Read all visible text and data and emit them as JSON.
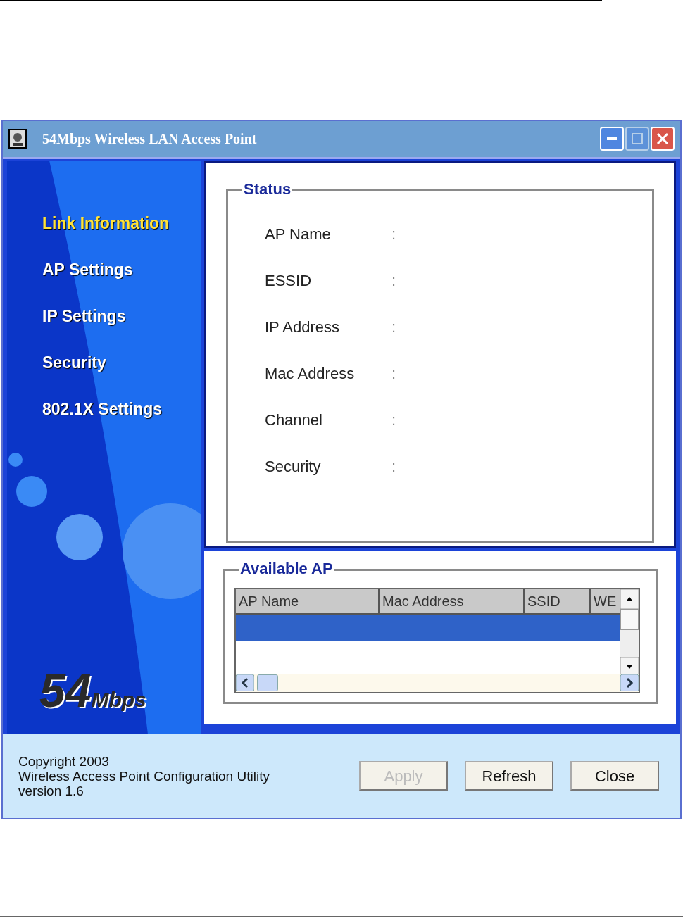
{
  "window": {
    "title": "54Mbps Wireless LAN Access Point",
    "controls": [
      {
        "kind": "minimize",
        "disabled": false
      },
      {
        "kind": "maximize",
        "disabled": true
      },
      {
        "kind": "close",
        "disabled": false
      }
    ]
  },
  "sidebar": {
    "items": [
      {
        "label": "Link Information",
        "selected": true
      },
      {
        "label": "AP Settings",
        "selected": false
      },
      {
        "label": "IP Settings",
        "selected": false
      },
      {
        "label": "Security",
        "selected": false
      },
      {
        "label": "802.1X Settings",
        "selected": false
      }
    ],
    "logo": {
      "number": "54",
      "unit": "Mbps"
    }
  },
  "status": {
    "title": "Status",
    "fields": [
      {
        "label": "AP Name",
        "separator": ":"
      },
      {
        "label": "ESSID",
        "separator": ":"
      },
      {
        "label": "IP Address",
        "separator": ":"
      },
      {
        "label": "Mac Address",
        "separator": ":"
      },
      {
        "label": "Channel",
        "separator": ":"
      },
      {
        "label": "Security",
        "separator": ":"
      }
    ]
  },
  "available_ap": {
    "title": "Available AP",
    "table": {
      "columns": [
        "AP Name",
        "Mac Address",
        "SSID",
        "WE"
      ],
      "rows": [
        {
          "selected": true
        }
      ]
    }
  },
  "footer": {
    "lines": [
      "Copyright 2003",
      "Wireless Access Point Configuration Utility",
      "version 1.6"
    ],
    "buttons": [
      {
        "label": "Apply",
        "disabled": true
      },
      {
        "label": "Refresh",
        "disabled": false
      },
      {
        "label": "Close",
        "disabled": false
      }
    ]
  }
}
